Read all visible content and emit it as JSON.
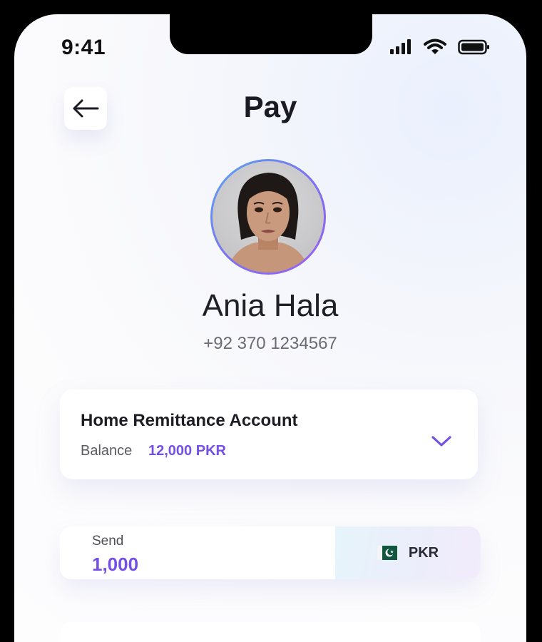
{
  "status_bar": {
    "time": "9:41"
  },
  "header": {
    "title": "Pay"
  },
  "contact": {
    "name": "Ania Hala",
    "phone": "+92 370 1234567"
  },
  "account": {
    "title": "Home Remittance Account",
    "balance_label": "Balance",
    "balance_value": "12,000 PKR"
  },
  "send": {
    "label": "Send",
    "amount": "1,000",
    "currency": "PKR"
  },
  "icons": {
    "back": "arrow-left-icon",
    "chevron": "chevron-down-icon",
    "flag": "pakistan-flag-icon"
  },
  "colors": {
    "accent": "#7450e6",
    "avatar_ring_start": "#59a6f2",
    "avatar_ring_end": "#9b5ff0"
  }
}
